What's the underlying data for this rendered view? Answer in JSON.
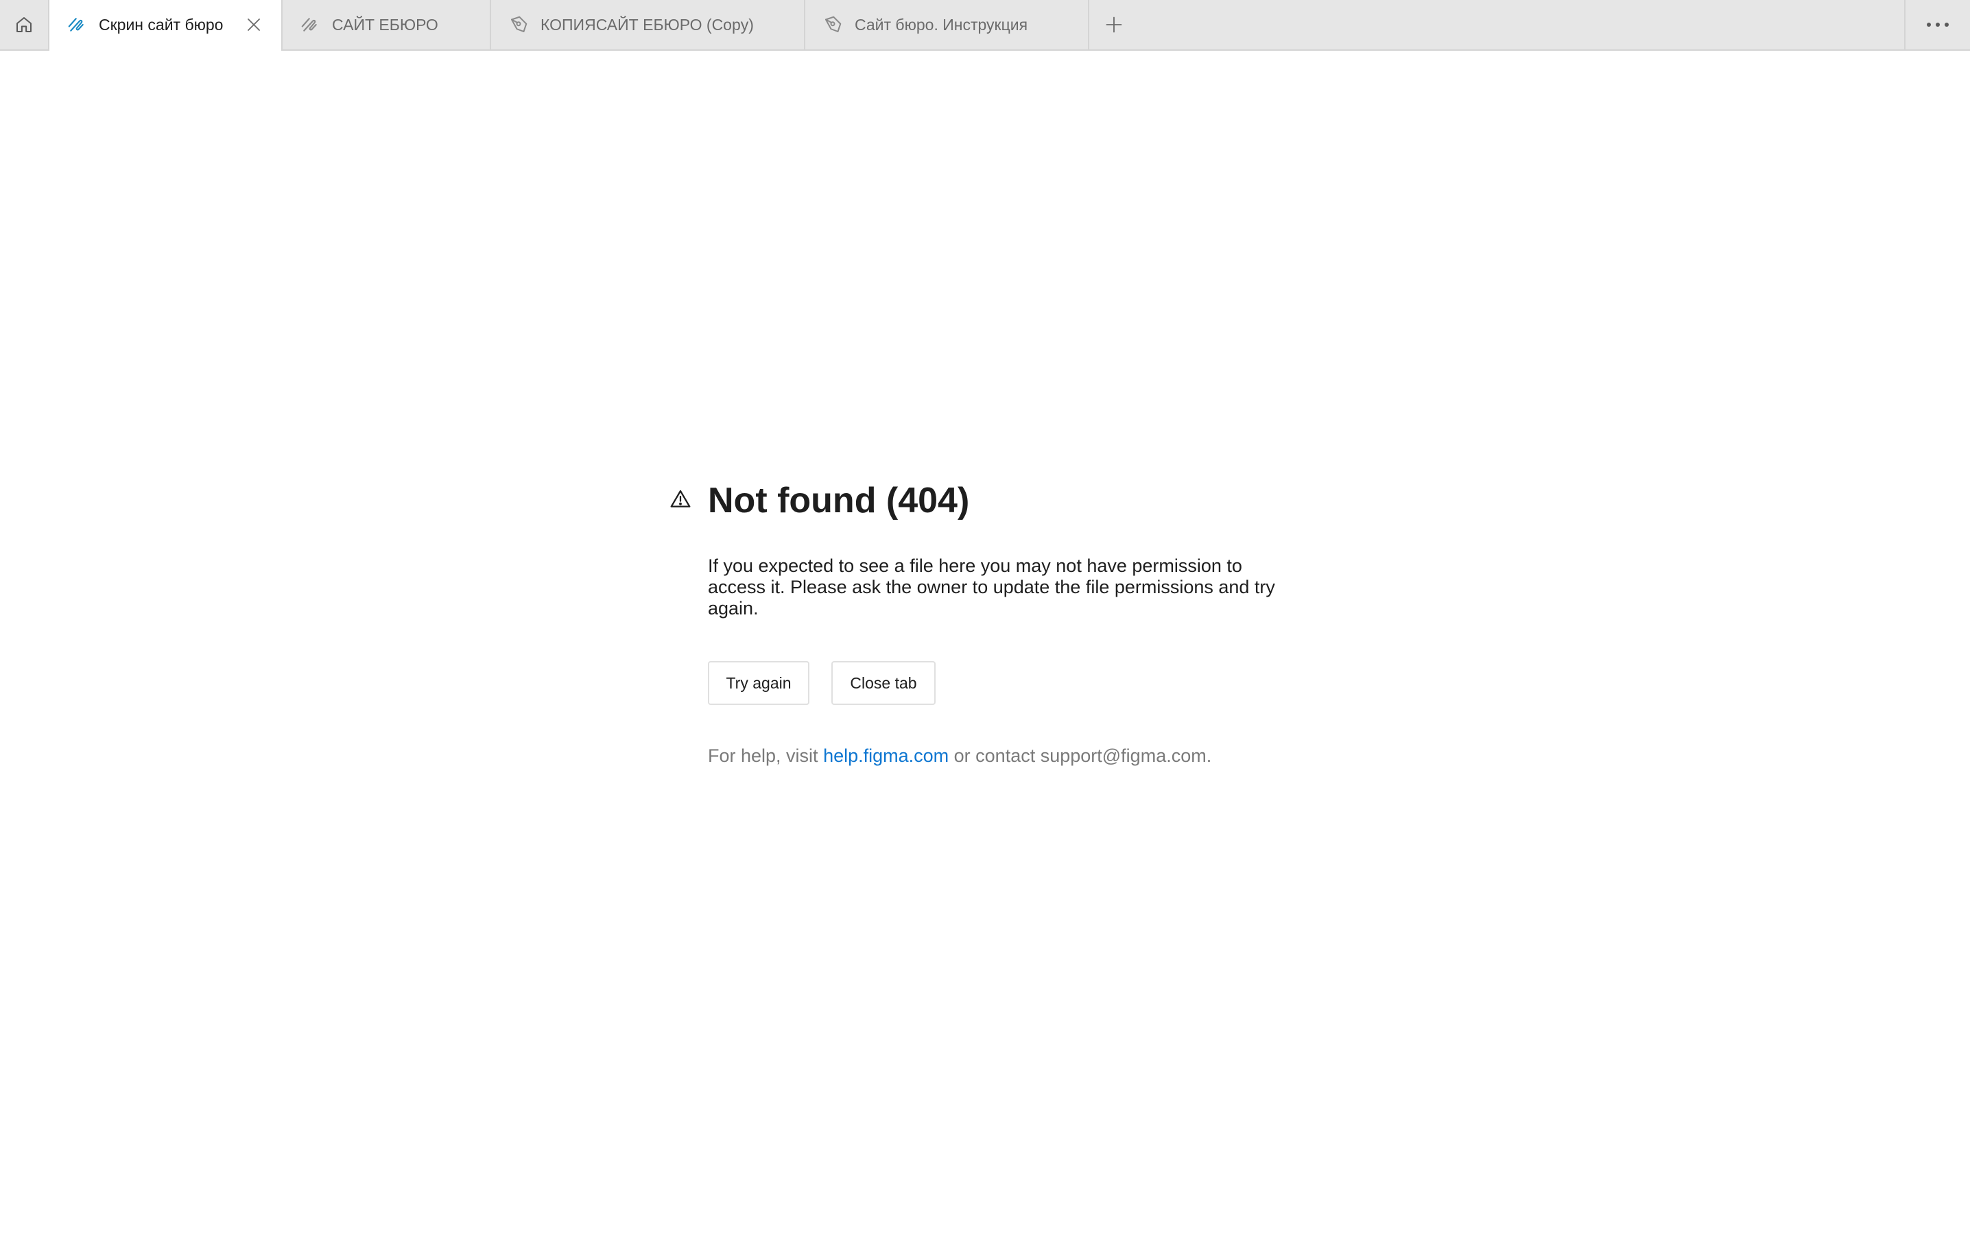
{
  "tabbar": {
    "home_icon": "home-icon",
    "tabs": [
      {
        "label": "Скрин сайт бюро",
        "icon": "figjam-icon",
        "active": true
      },
      {
        "label": "САЙТ ЕБЮРО",
        "icon": "figjam-icon",
        "active": false
      },
      {
        "label": "КОПИЯСАЙТ ЕБЮРО (Copy)",
        "icon": "design-file-icon",
        "active": false
      },
      {
        "label": "Сайт бюро. Инструкция",
        "icon": "design-file-icon",
        "active": false
      }
    ],
    "add_icon": "plus-icon",
    "more_icon": "more-icon"
  },
  "error": {
    "icon": "warning-icon",
    "title": "Not found (404)",
    "message": "If you expected to see a file here you may not have permission to access it. Please ask the owner to update the file permissions and try again.",
    "try_again_label": "Try again",
    "close_tab_label": "Close tab",
    "help_prefix": "For help, visit ",
    "help_link": "help.figma.com",
    "help_suffix": " or contact support@figma.com."
  },
  "colors": {
    "tabbar_bg": "#e6e6e6",
    "active_tab_bg": "#ffffff",
    "active_icon": "#1b8bc4",
    "link": "#0d76d1",
    "muted_text": "#7a7a7a"
  }
}
